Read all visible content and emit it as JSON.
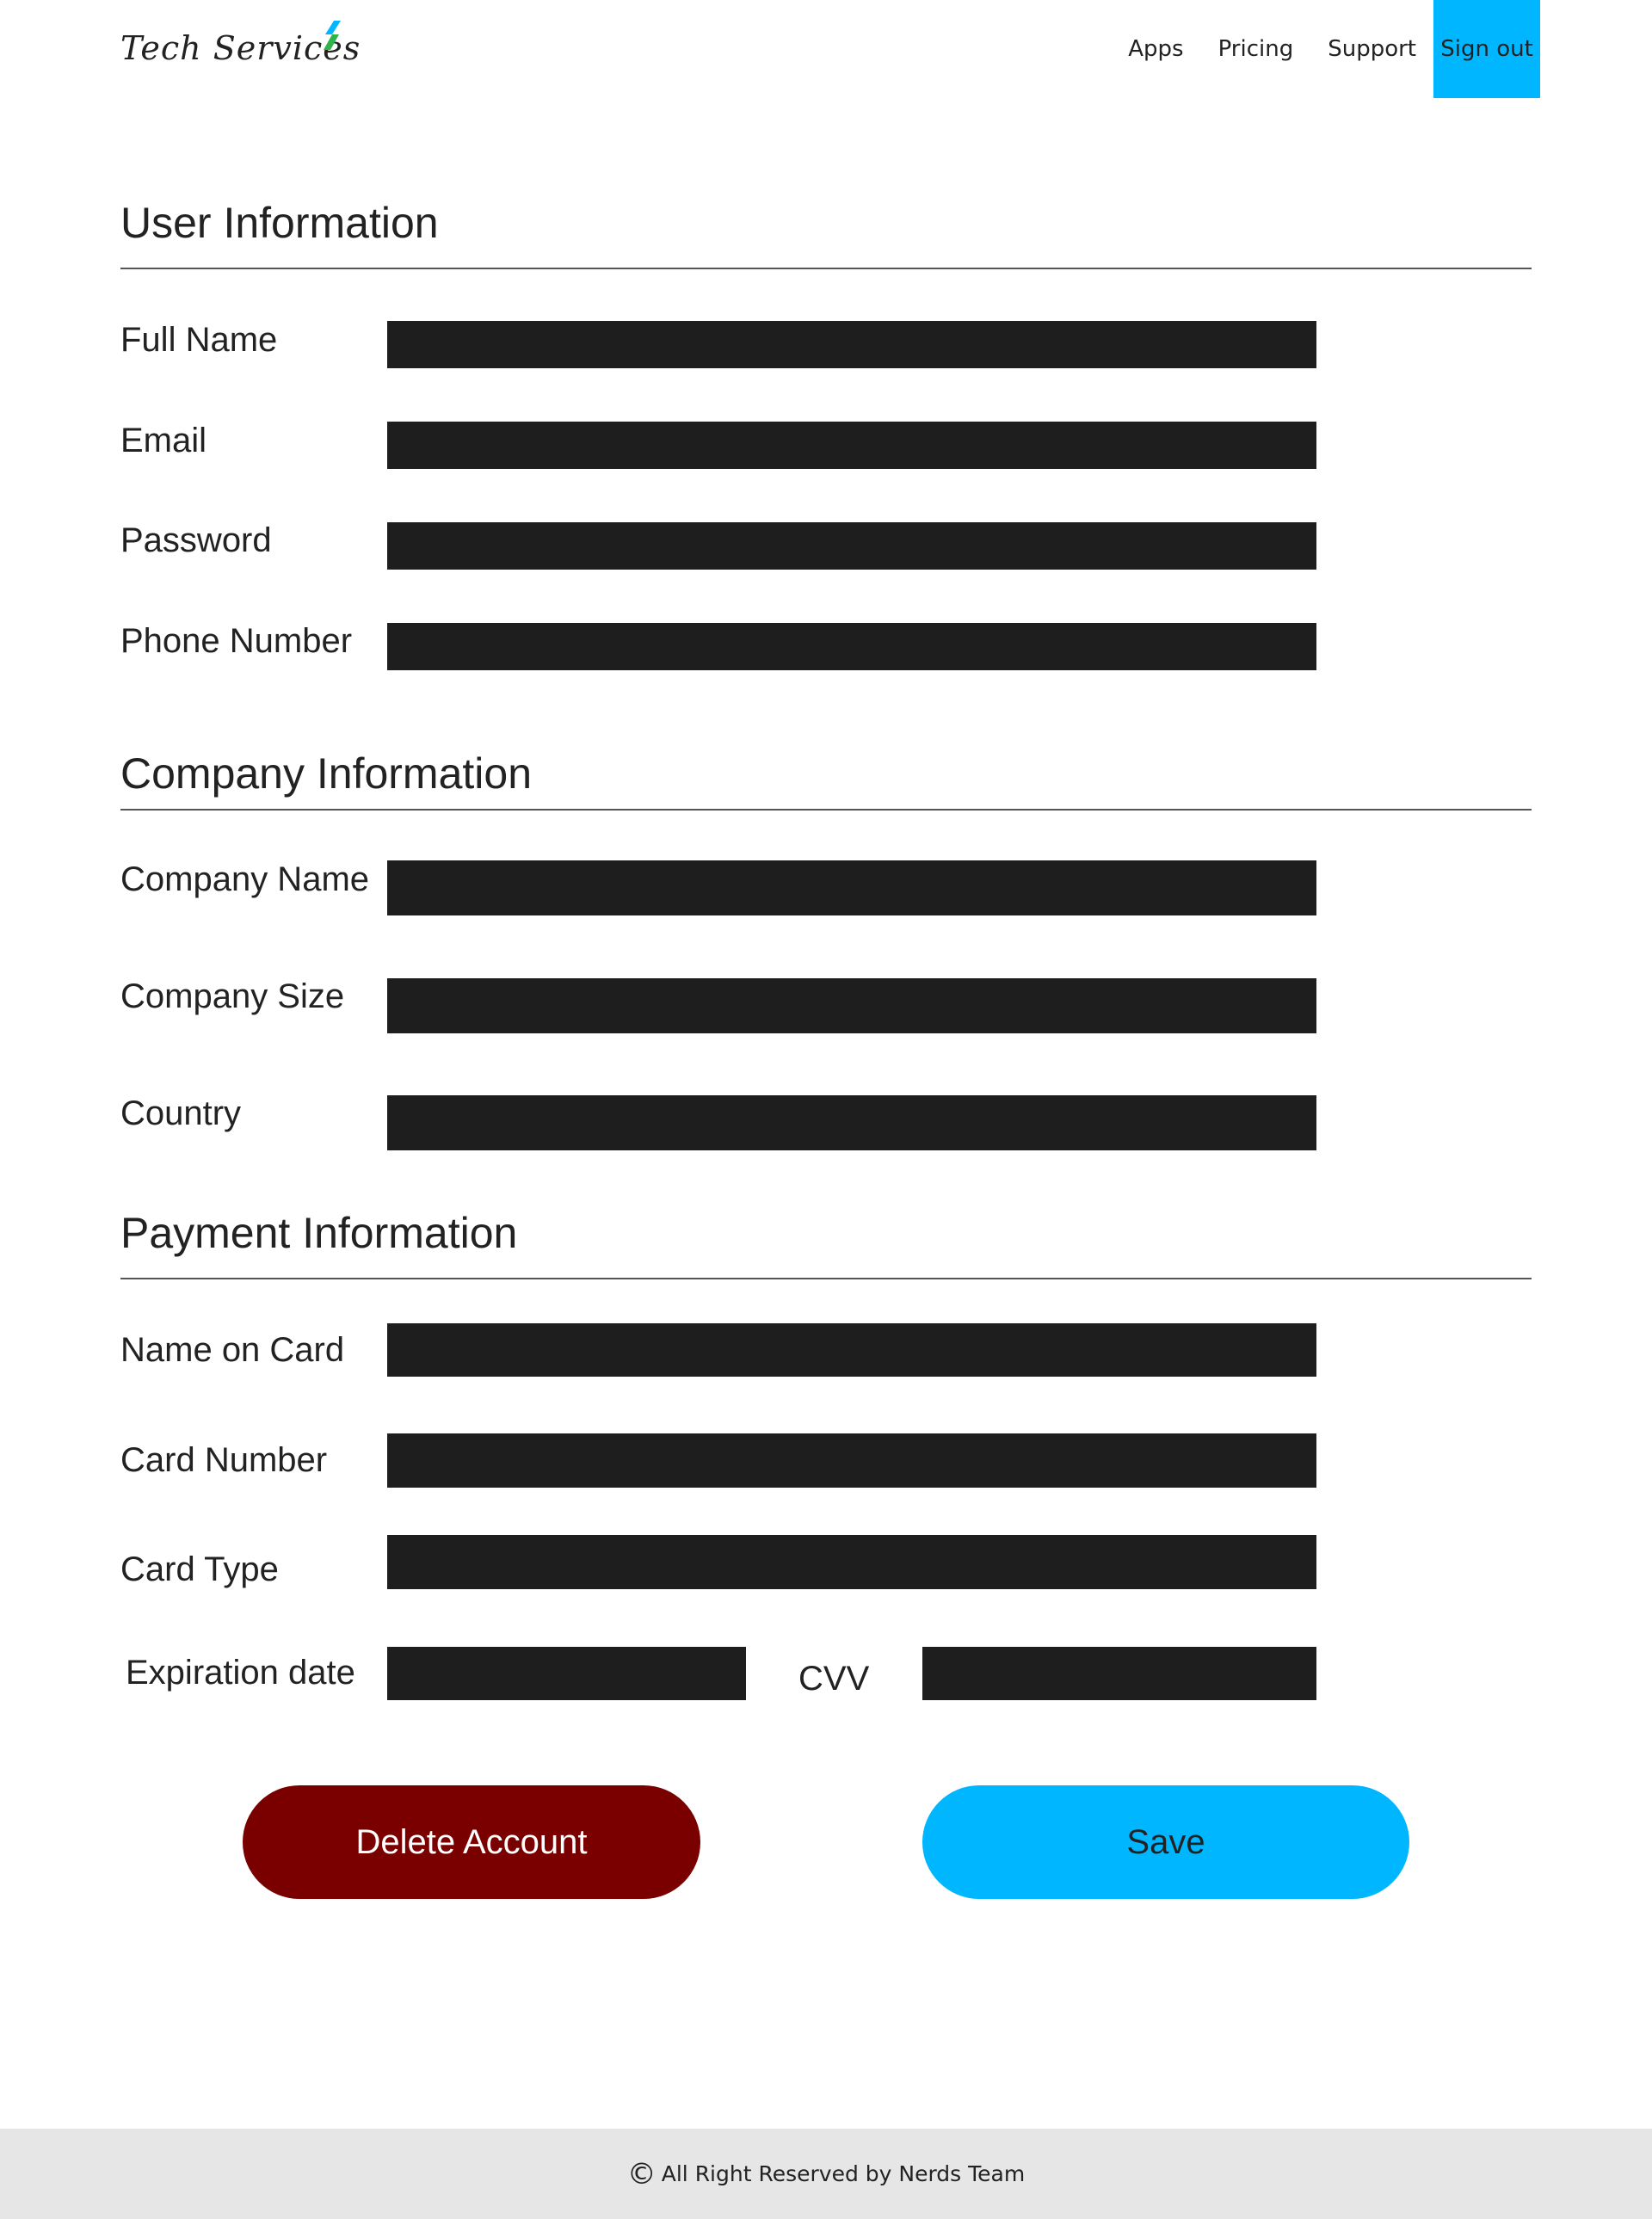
{
  "header": {
    "brand": "Tech Services",
    "nav": [
      "Apps",
      "Pricing",
      "Support",
      "Sign out"
    ]
  },
  "sections": {
    "user": {
      "title": "User Information",
      "fields": [
        "Full Name",
        "Email",
        "Password",
        "Phone Number"
      ]
    },
    "company": {
      "title": "Company Information",
      "fields": [
        "Company Name",
        "Company Size",
        "Country"
      ]
    },
    "payment": {
      "title": "Payment Information",
      "fields": [
        "Name on Card",
        "Card Number",
        "Card Type",
        "Expiration date",
        "CVV"
      ]
    }
  },
  "actions": {
    "delete_label": "Delete Account",
    "save_label": "Save"
  },
  "footer": {
    "copyright_symbol": "©",
    "text": "All Right Reserved by Nerds Team"
  },
  "colors": {
    "accent": "#00b7ff",
    "danger": "#7a0000",
    "input_fill": "#1e1e1e",
    "footer_bg": "#e6e6e6"
  }
}
